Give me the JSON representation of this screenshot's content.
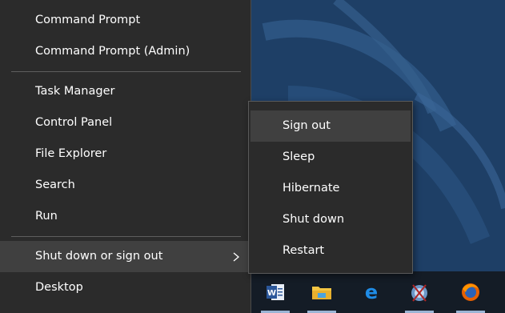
{
  "menu": {
    "items": [
      {
        "label": "Command Prompt"
      },
      {
        "label": "Command Prompt (Admin)"
      },
      {
        "label": "Task Manager"
      },
      {
        "label": "Control Panel"
      },
      {
        "label": "File Explorer"
      },
      {
        "label": "Search"
      },
      {
        "label": "Run"
      },
      {
        "label": "Shut down or sign out"
      },
      {
        "label": "Desktop"
      }
    ]
  },
  "submenu": {
    "items": [
      {
        "label": "Sign out"
      },
      {
        "label": "Sleep"
      },
      {
        "label": "Hibernate"
      },
      {
        "label": "Shut down"
      },
      {
        "label": "Restart"
      }
    ]
  },
  "taskbar": {
    "apps": [
      {
        "icon": "word-icon"
      },
      {
        "icon": "file-explorer-icon"
      },
      {
        "icon": "edge-icon"
      },
      {
        "icon": "app-icon"
      },
      {
        "icon": "firefox-icon"
      }
    ]
  },
  "colors": {
    "menu_bg": "#2b2b2b",
    "hover_bg": "#404040",
    "desktop_bg": "#1e3f66",
    "taskbar_bg": "#141c26"
  }
}
